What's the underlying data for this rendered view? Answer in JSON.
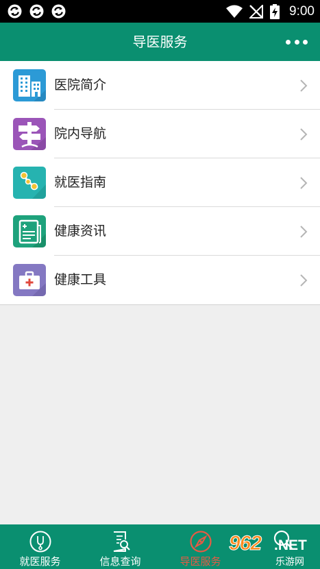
{
  "status_bar": {
    "time": "9:00"
  },
  "header": {
    "title": "导医服务",
    "more_icon": "more-dots-icon"
  },
  "menu": {
    "items": [
      {
        "label": "医院简介",
        "icon": "hospital-building-icon",
        "color": "#2c9ad6"
      },
      {
        "label": "院内导航",
        "icon": "signpost-icon",
        "color": "#9b55b8"
      },
      {
        "label": "就医指南",
        "icon": "route-icon",
        "color": "#26b3b0"
      },
      {
        "label": "健康资讯",
        "icon": "health-news-icon",
        "color": "#1ea27c"
      },
      {
        "label": "健康工具",
        "icon": "medical-kit-icon",
        "color": "#8478c2"
      }
    ]
  },
  "tabbar": {
    "tabs": [
      {
        "label": "就医服务",
        "icon": "stethoscope-icon",
        "active": false
      },
      {
        "label": "信息查询",
        "icon": "document-search-icon",
        "active": false
      },
      {
        "label": "导医服务",
        "icon": "compass-icon",
        "active": true
      },
      {
        "label": "",
        "icon": "search-icon",
        "active": false
      }
    ]
  },
  "watermark": {
    "number": "962",
    "domain": ".NET",
    "text": "乐游网"
  },
  "colors": {
    "primary": "#0a8f70",
    "active_tab": "#e85a44",
    "background": "#efefef"
  }
}
